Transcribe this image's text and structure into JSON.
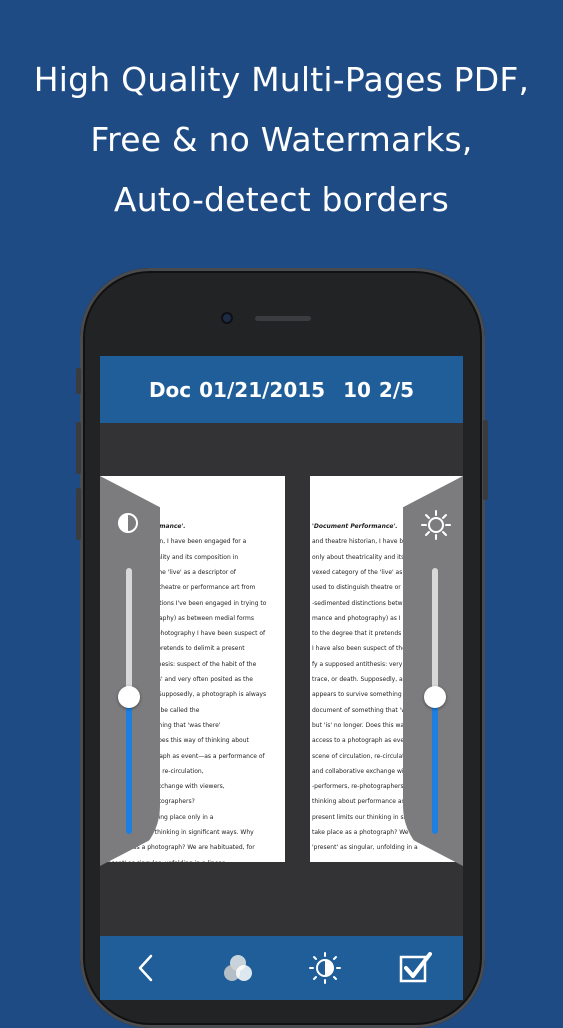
{
  "headline": {
    "line1": "High Quality Multi-Pages PDF,",
    "line2": "Free & no Watermarks,",
    "line3": "Auto-detect borders"
  },
  "titlebar": {
    "doc_label": "Doc",
    "date": "01/21/2015",
    "time": "10",
    "page": "2/5"
  },
  "left_page_lines": [
    "'Document Performance'.",
    "and theatre historian, I have been engaged for a",
    "only about theatricality and its composition in",
    "vexed category of the 'live' as a descriptor of",
    "used to distinguish theatre or performance art from",
    "-sedimented distinctions I've been engaged in trying to",
    "mance and photography) as between medial forms",
    "to the degree that photography I have been suspect of",
    "I have also been it pretends to delimit a present",
    "fy a supposed antithesis: suspect of the habit of the",
    "trace, or death. 'It is' and very often posited as the",
    "appears to survive Supposedly, a photograph is always",
    "something that can be called the",
    "document of something that 'was there'",
    "but 'is' no longer. Does this way of thinking about",
    "access to a photograph as event—as a performance of",
    "scene of circulation, re-circulation,",
    "and collaborative exchange with viewers,",
    "-performers, re-photographers?",
    "performance as taking place only in a",
    "present limits our thinking in significant ways. Why",
    "take place as a photograph? We are habituated, for",
    "'present' as singular, unfolding in a linear"
  ],
  "right_page_lines": [
    "'Document Performance'.",
    "and theatre historian, I have been",
    "only about theatricality and its composition",
    "vexed category of the 'live' as a desc",
    "used to distinguish theatre or perfor",
    "-sedimented distinctions between medi",
    "mance and photography) as I have bee",
    "to the degree that it pretends to deli",
    "I have also been suspect of the habit",
    "fy a supposed antithesis: very often",
    "trace, or death. Supposedly, a photog",
    "appears to survive something that ca",
    "document of something that 'was the",
    "but 'is' no longer. Does this way of",
    "access to a photograph as event—as a",
    "scene of circulation, re-circulation,",
    "and collaborative exchange with vie",
    "-performers, re-photographers?",
    "thinking about performance as taking",
    "present limits our thinking in signific",
    "take place as a photograph? We are",
    "'present' as singular, unfolding in a"
  ],
  "sliders": {
    "contrast_icon": "contrast-icon",
    "brightness_icon": "sun-icon",
    "contrast_level": 0.5,
    "brightness_level": 0.5,
    "accent_color": "#1e7fe0"
  },
  "toolbar": {
    "back_icon": "chevron-left-icon",
    "filter_icon": "color-filter-icon",
    "brightness_icon": "half-sun-icon",
    "confirm_icon": "checkbox-check-icon"
  },
  "colors": {
    "background": "#1f4b84",
    "bar": "#1f5e99"
  }
}
